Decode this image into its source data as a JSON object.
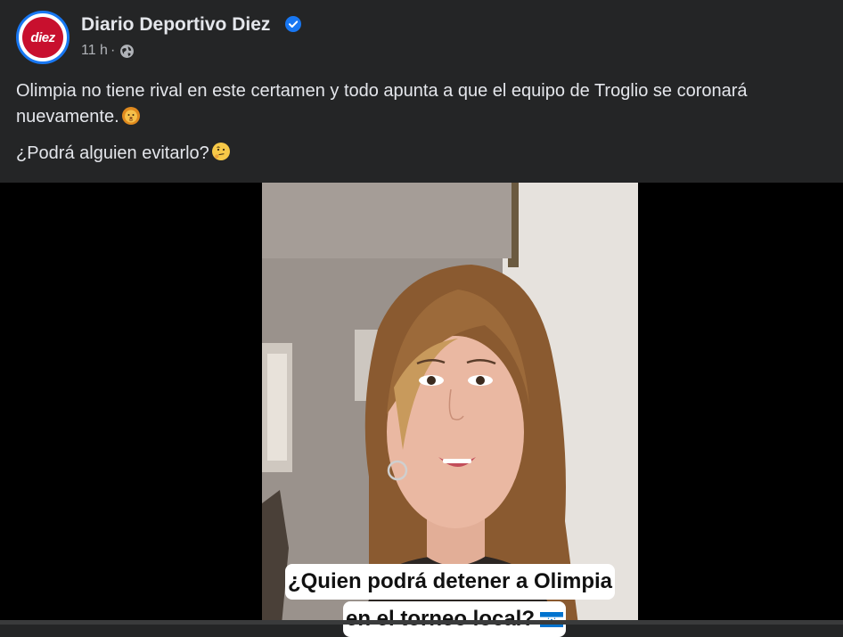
{
  "post": {
    "page_name": "Diario Deportivo Diez",
    "avatar_text": "diez",
    "timestamp": "11 h",
    "separator": "·",
    "text_line1": "Olimpia no tiene rival en este certamen y todo apunta a que el equipo de Troglio se coronará nuevamente.",
    "text_line2": "¿Podrá alguien evitarlo?",
    "emoji1": "lion-face-emoji",
    "emoji2": "thinking-face-emoji"
  },
  "video": {
    "caption_line1": "¿Quien podrá detener a Olimpia",
    "caption_line2": "en el torneo local?",
    "caption_flag": "honduras-flag-emoji"
  },
  "colors": {
    "background": "#242526",
    "text": "#e4e6eb",
    "secondary_text": "#b0b3b8",
    "verified_badge": "#1877f2",
    "brand_red": "#c8102e"
  }
}
